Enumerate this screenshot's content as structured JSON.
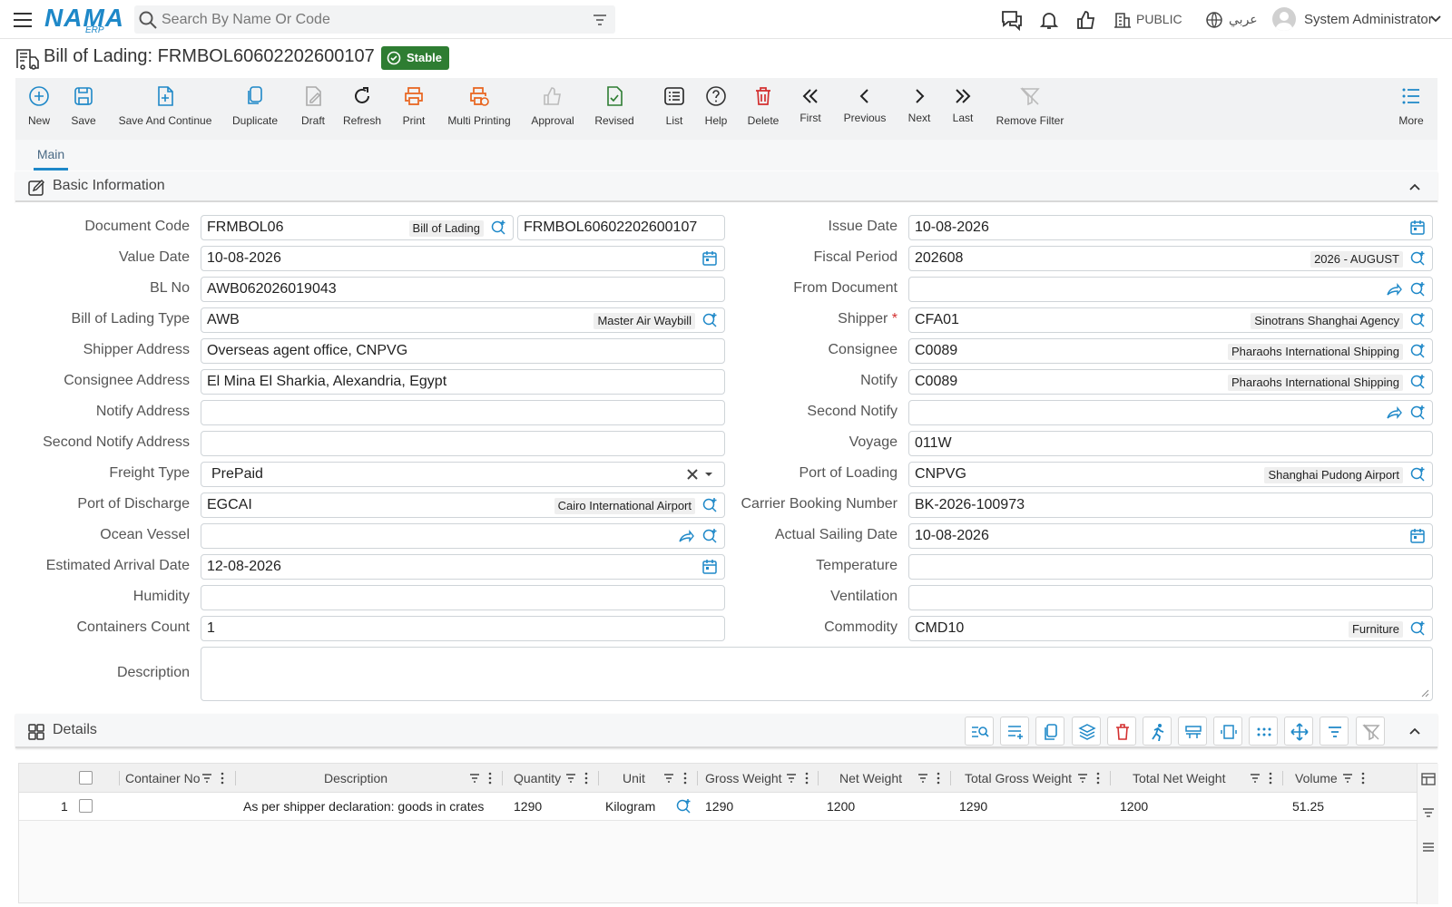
{
  "topbar": {
    "logo_main": "NAMA",
    "logo_sub": "ERP",
    "search_placeholder": "Search By Name Or Code",
    "public_label": "PUBLIC",
    "lang_label": "عربي",
    "user_name": "System Administrator"
  },
  "page": {
    "title": "Bill of Lading: FRMBOL60602202600107",
    "status": "Stable"
  },
  "toolbar": {
    "new": "New",
    "save": "Save",
    "save_continue": "Save And Continue",
    "duplicate": "Duplicate",
    "draft": "Draft",
    "refresh": "Refresh",
    "print": "Print",
    "multi_printing": "Multi Printing",
    "approval": "Approval",
    "revised": "Revised",
    "list": "List",
    "help": "Help",
    "delete": "Delete",
    "first": "First",
    "previous": "Previous",
    "next": "Next",
    "last": "Last",
    "remove_filter": "Remove Filter",
    "more": "More"
  },
  "tabs": {
    "main": "Main"
  },
  "sections": {
    "basic": "Basic Information",
    "details": "Details"
  },
  "form": {
    "document_code": {
      "label": "Document Code",
      "value": "FRMBOL06",
      "desc": "Bill of Lading",
      "code": "FRMBOL60602202600107"
    },
    "value_date": {
      "label": "Value Date",
      "value": "10-08-2026"
    },
    "bl_no": {
      "label": "BL No",
      "value": "AWB062026019043"
    },
    "bl_type": {
      "label": "Bill of Lading Type",
      "value": "AWB",
      "desc": "Master Air Waybill"
    },
    "shipper_address": {
      "label": "Shipper Address",
      "value": "Overseas agent office, CNPVG"
    },
    "consignee_address": {
      "label": "Consignee Address",
      "value": "El Mina El Sharkia, Alexandria, Egypt"
    },
    "notify_address": {
      "label": "Notify Address",
      "value": ""
    },
    "second_notify_address": {
      "label": "Second Notify Address",
      "value": ""
    },
    "freight_type": {
      "label": "Freight Type",
      "value": "PrePaid"
    },
    "port_discharge": {
      "label": "Port of Discharge",
      "value": "EGCAI",
      "desc": "Cairo International Airport"
    },
    "ocean_vessel": {
      "label": "Ocean Vessel",
      "value": ""
    },
    "eta": {
      "label": "Estimated Arrival Date",
      "value": "12-08-2026"
    },
    "humidity": {
      "label": "Humidity",
      "value": ""
    },
    "containers_count": {
      "label": "Containers Count",
      "value": "1"
    },
    "issue_date": {
      "label": "Issue Date",
      "value": "10-08-2026"
    },
    "fiscal_period": {
      "label": "Fiscal Period",
      "value": "202608",
      "desc": "2026 - AUGUST"
    },
    "from_document": {
      "label": "From Document",
      "value": ""
    },
    "shipper": {
      "label": "Shipper",
      "required": "*",
      "value": "CFA01",
      "desc": "Sinotrans Shanghai Agency"
    },
    "consignee": {
      "label": "Consignee",
      "value": "C0089",
      "desc": "Pharaohs International Shipping"
    },
    "notify": {
      "label": "Notify",
      "value": "C0089",
      "desc": "Pharaohs International Shipping"
    },
    "second_notify": {
      "label": "Second Notify",
      "value": ""
    },
    "voyage": {
      "label": "Voyage",
      "value": "011W"
    },
    "port_loading": {
      "label": "Port of Loading",
      "value": "CNPVG",
      "desc": "Shanghai Pudong Airport"
    },
    "carrier_booking": {
      "label": "Carrier Booking Number",
      "value": "BK-2026-100973"
    },
    "actual_sailing": {
      "label": "Actual Sailing Date",
      "value": "10-08-2026"
    },
    "temperature": {
      "label": "Temperature",
      "value": ""
    },
    "ventilation": {
      "label": "Ventilation",
      "value": ""
    },
    "commodity": {
      "label": "Commodity",
      "value": "CMD10",
      "desc": "Furniture"
    },
    "description": {
      "label": "Description",
      "value": ""
    }
  },
  "grid": {
    "columns": [
      "Container No",
      "Description",
      "Quantity",
      "Unit",
      "Gross Weight",
      "Net Weight",
      "Total Gross Weight",
      "Total Net Weight",
      "Volume"
    ],
    "rows": [
      {
        "num": "1",
        "container_no": "",
        "description": "As per shipper declaration: goods in crates",
        "quantity": "1290",
        "unit": "Kilogram",
        "gross_weight": "1290",
        "net_weight": "1200",
        "total_gross_weight": "1290",
        "total_net_weight": "1200",
        "volume": "51.25"
      }
    ]
  },
  "colors": {
    "accent": "#1e88c8",
    "status_green": "#2e7d32",
    "print_orange": "#e8631c",
    "delete_red": "#d32f2f",
    "revised_green": "#2e7d32"
  }
}
